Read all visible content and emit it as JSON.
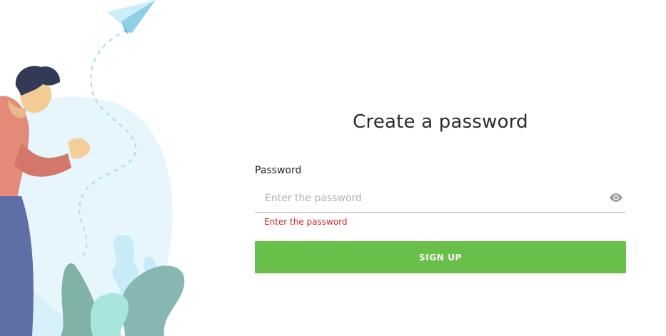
{
  "form": {
    "title": "Create a password",
    "password_label": "Password",
    "password_placeholder": "Enter the password",
    "password_value": "",
    "error_message": "Enter the password",
    "submit_label": "SIGN UP",
    "reveal_icon": "eye-icon"
  },
  "colors": {
    "primary_button": "#6abf4b",
    "error": "#c62828",
    "illustration_blob": "#e6f6fc",
    "paper_plane": "#6fc0dc"
  }
}
